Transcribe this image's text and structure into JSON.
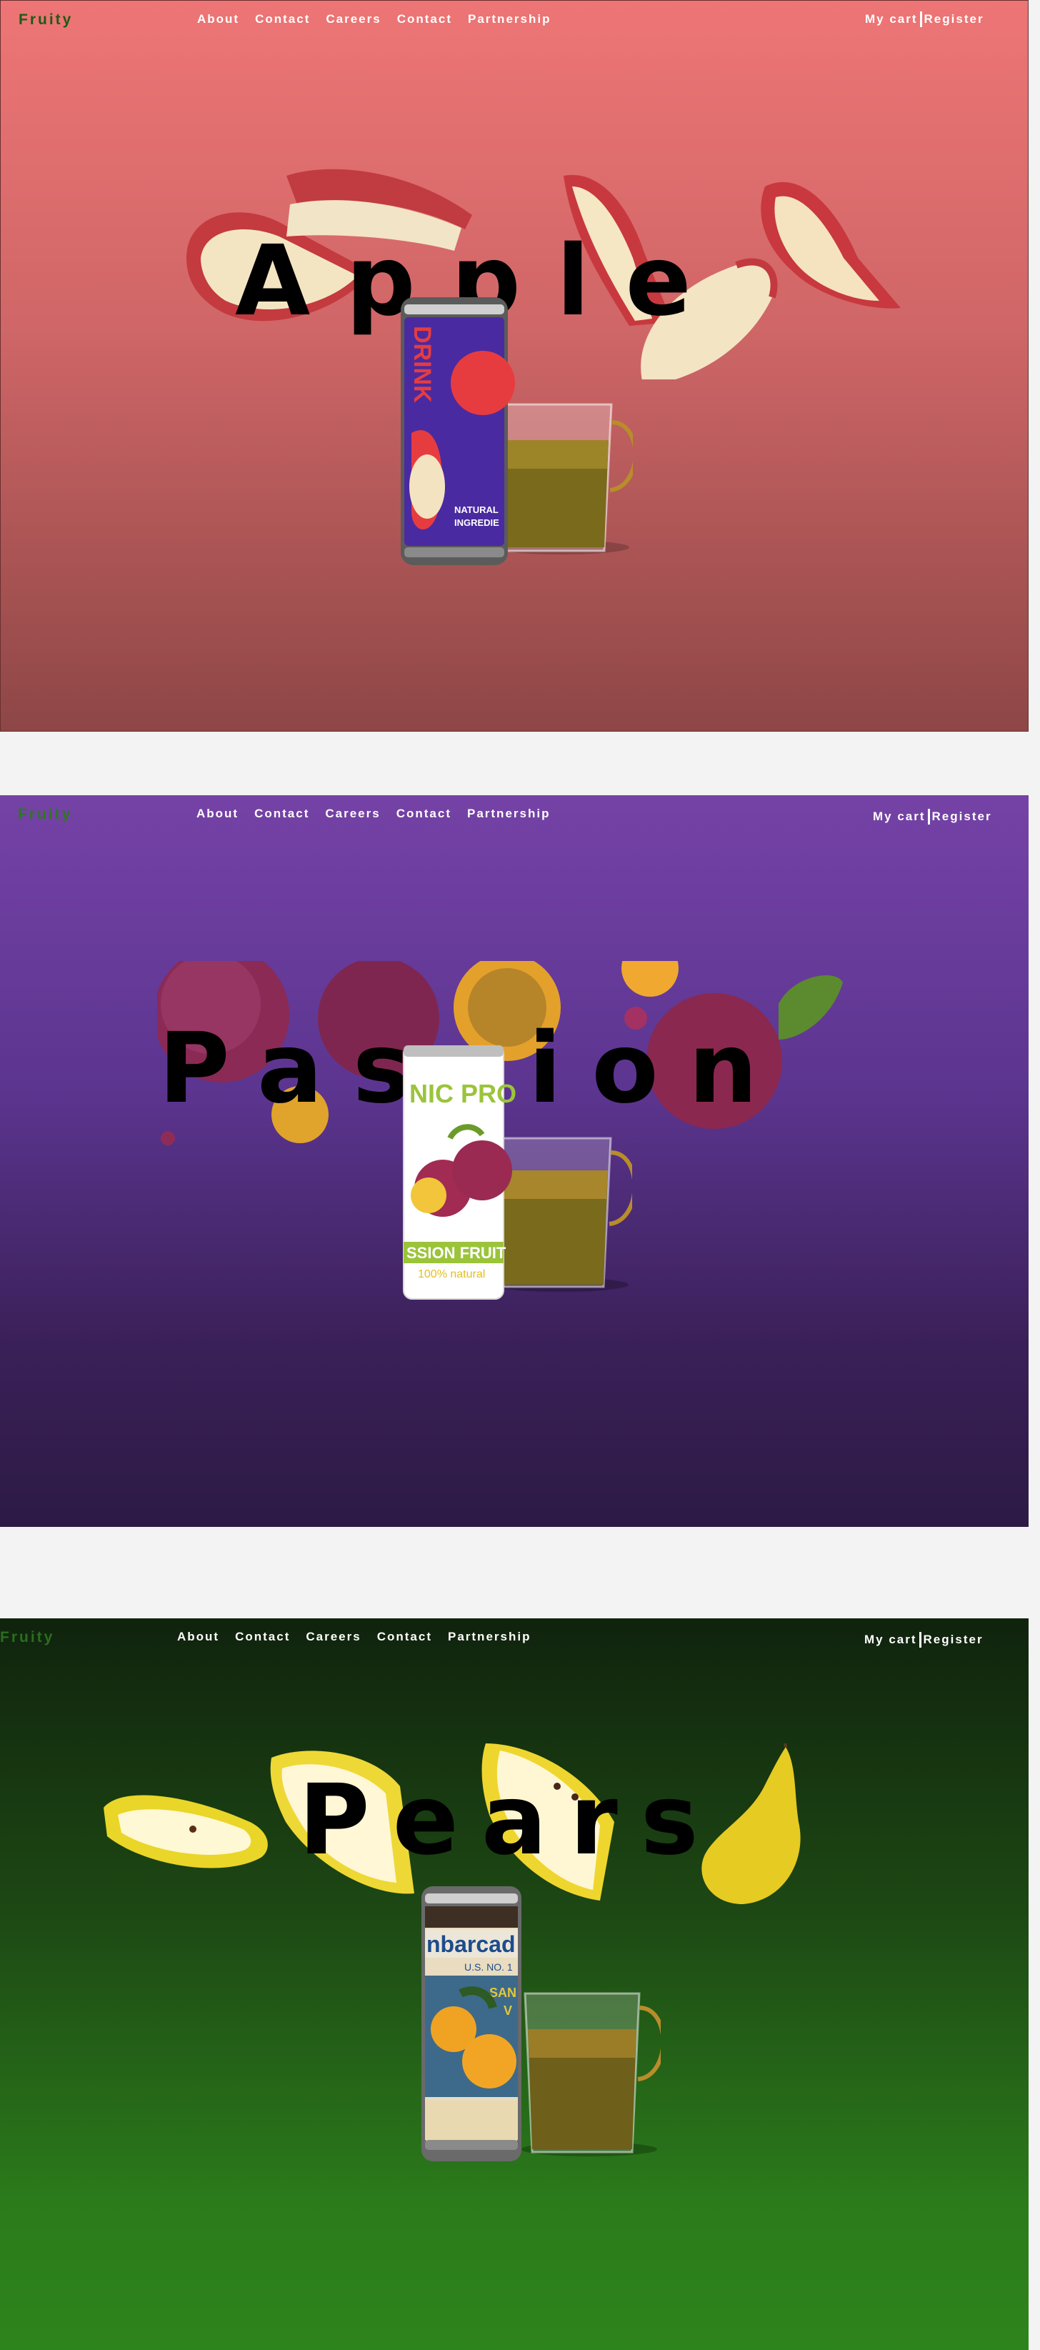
{
  "nav": {
    "logo": "Fruity",
    "links": [
      "About",
      "Contact",
      "Careers",
      "Contact",
      "Partnership"
    ],
    "cart": "My cart",
    "register": "Register"
  },
  "sections": [
    {
      "id": "apple",
      "title": "Apple",
      "can_label_main": "DRINK",
      "can_label_sub": [
        "NATURAL",
        "INGREDIE"
      ],
      "colors": {
        "bg_top": "#ee7575",
        "bg_bottom": "#8e4646",
        "logo": "#1e5a16"
      }
    },
    {
      "id": "passion",
      "title": "Passion",
      "can_label_top": "NIC PRO",
      "can_label_main": "SSION FRUIT",
      "can_label_sub": "100% natural",
      "colors": {
        "bg_top": "#7542a6",
        "bg_bottom": "#2d1a45",
        "logo": "#2a7a1e"
      }
    },
    {
      "id": "pears",
      "title": "Pears",
      "can_label_main": "nbarcad",
      "can_label_sub": [
        "U.S. NO. 1",
        "SAN",
        "V"
      ],
      "colors": {
        "bg_top": "#10230d",
        "bg_bottom": "#2e841c",
        "logo": "#2a6e1e"
      }
    }
  ]
}
